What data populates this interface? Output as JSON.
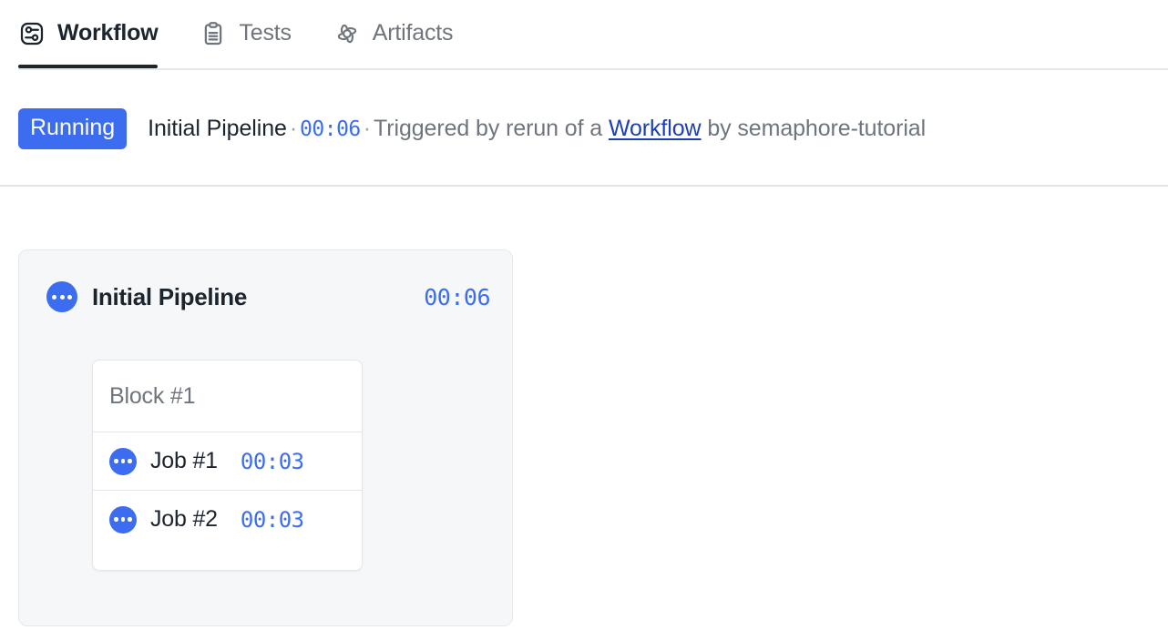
{
  "tabs": [
    {
      "label": "Workflow",
      "icon": "workflow-icon",
      "active": true
    },
    {
      "label": "Tests",
      "icon": "clipboard-icon",
      "active": false
    },
    {
      "label": "Artifacts",
      "icon": "artifacts-icon",
      "active": false
    }
  ],
  "status": {
    "badge": "Running",
    "pipeline_name": "Initial Pipeline",
    "separator": "·",
    "duration": "00:06",
    "triggered_prefix": "Triggered by rerun of a ",
    "trigger_link": "Workflow",
    "triggered_suffix": " by semaphore-tutorial"
  },
  "pipeline": {
    "status_icon": "running-ellipsis-icon",
    "name": "Initial Pipeline",
    "duration": "00:06",
    "block": {
      "title": "Block #1",
      "jobs": [
        {
          "status_icon": "running-ellipsis-icon",
          "name": "Job #1",
          "duration": "00:03"
        },
        {
          "status_icon": "running-ellipsis-icon",
          "name": "Job #2",
          "duration": "00:03"
        }
      ]
    }
  },
  "colors": {
    "accent_blue": "#3c6df0",
    "link_blue": "#1d3fb5",
    "text_dark": "#1c252e",
    "text_muted": "#6e757c",
    "card_bg": "#f6f7f8",
    "border": "#e3e6ea"
  }
}
